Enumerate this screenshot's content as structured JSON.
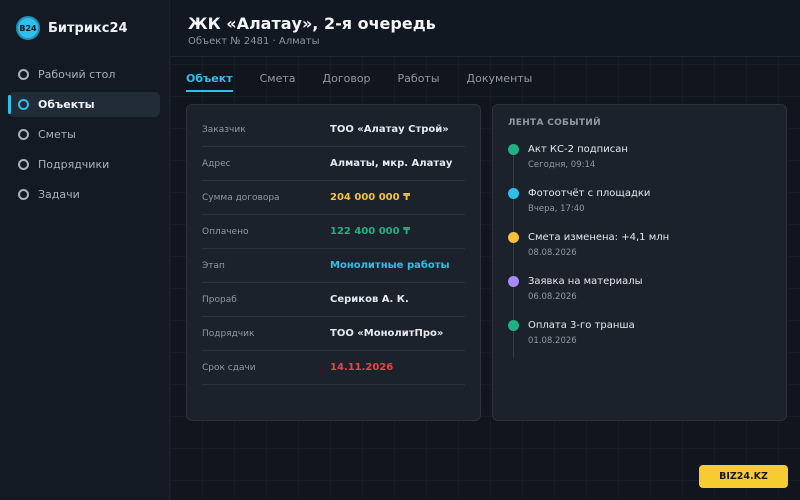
{
  "brand": {
    "logo_text": "B24",
    "name": "Битрикс24",
    "accent": "#2fbfea"
  },
  "sidebar": {
    "items": [
      {
        "label": "Рабочий стол",
        "active": false
      },
      {
        "label": "Объекты",
        "active": true
      },
      {
        "label": "Сметы",
        "active": false
      },
      {
        "label": "Подрядчики",
        "active": false
      },
      {
        "label": "Задачи",
        "active": false
      }
    ]
  },
  "header": {
    "title": "ЖК «Алатау», 2-я очередь",
    "subtitle": "Объект № 2481 · Алматы"
  },
  "tabs": [
    {
      "label": "Объект",
      "active": true
    },
    {
      "label": "Смета",
      "active": false
    },
    {
      "label": "Договор",
      "active": false
    },
    {
      "label": "Работы",
      "active": false
    },
    {
      "label": "Документы",
      "active": false
    }
  ],
  "details": [
    {
      "label": "Заказчик",
      "value": "ТОО «Алатау Строй»",
      "color": "#e6e9ee"
    },
    {
      "label": "Адрес",
      "value": "Алматы, мкр. Алатау",
      "color": "#e6e9ee"
    },
    {
      "label": "Сумма договора",
      "value": "204 000 000 ₸",
      "color": "#f5c33b"
    },
    {
      "label": "Оплачено",
      "value": "122 400 000 ₸",
      "color": "#21b07f"
    },
    {
      "label": "Этап",
      "value": "Монолитные работы",
      "color": "#2fbfea"
    },
    {
      "label": "Прораб",
      "value": "Сериков А. К.",
      "color": "#e6e9ee"
    },
    {
      "label": "Подрядчик",
      "value": "ТОО «МонолитПро»",
      "color": "#e6e9ee"
    },
    {
      "label": "Срок сдачи",
      "value": "14.11.2026",
      "color": "#ea4545"
    }
  ],
  "feed": {
    "title": "ЛЕНТА СОБЫТИЙ",
    "events": [
      {
        "title": "Акт КС-2 подписан",
        "time": "Сегодня, 09:14",
        "color": "#21b07f"
      },
      {
        "title": "Фотоотчёт с площадки",
        "time": "Вчера, 17:40",
        "color": "#2fbfea"
      },
      {
        "title": "Смета изменена: +4,1 млн",
        "time": "08.08.2026",
        "color": "#f5c33b"
      },
      {
        "title": "Заявка на материалы",
        "time": "06.08.2026",
        "color": "#a78bfa"
      },
      {
        "title": "Оплата 3-го транша",
        "time": "01.08.2026",
        "color": "#21b07f"
      }
    ]
  },
  "watermark": {
    "text": "BIZ24.KZ",
    "color": "#f7cc31"
  }
}
